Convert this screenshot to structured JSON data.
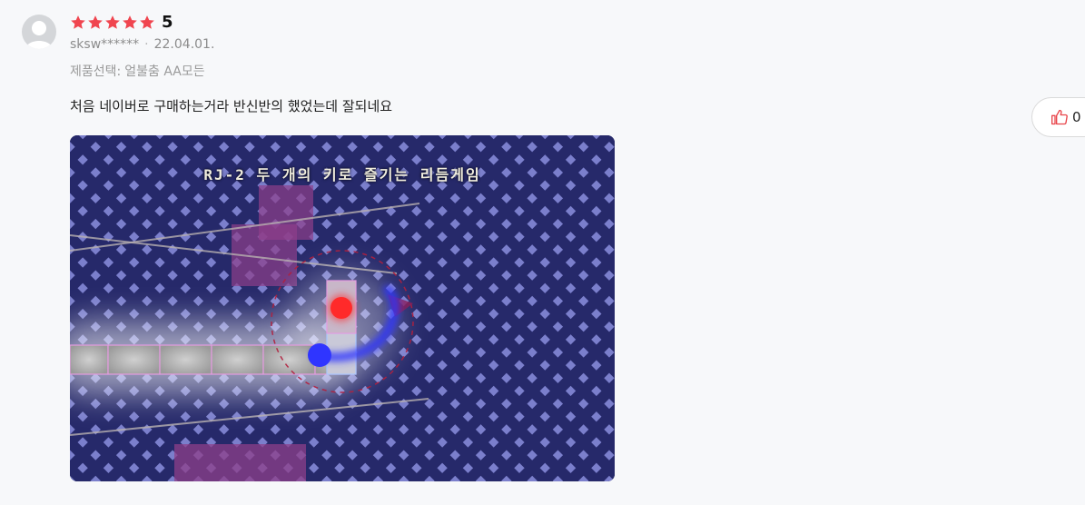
{
  "review": {
    "rating_stars": 5,
    "rating_value": "5",
    "author": "sksw******",
    "date": "22.04.01.",
    "option_label": "제품선택:",
    "option_value": "얼불춤 AA모든",
    "text": "처음 네이버로 구매하는거라 반신반의 했었는데 잘되네요"
  },
  "like": {
    "count": "0",
    "icon": "thumbs-up-icon"
  },
  "photo": {
    "caption": "RJ-2 두 개의 키로 즐기는 리듬게임",
    "colors": {
      "background": "#26296a",
      "red_planet": "#ff2a2a",
      "blue_planet": "#2f35ff"
    }
  },
  "colors": {
    "star": "#f0454f",
    "like_icon": "#e8444a"
  }
}
